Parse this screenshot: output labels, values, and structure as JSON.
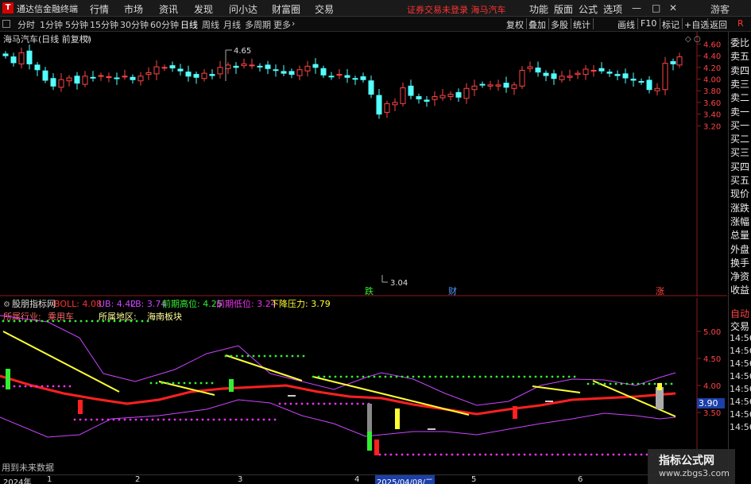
{
  "titlebar": {
    "app_name": "通达信金融终端",
    "menu": [
      "行情",
      "市场",
      "资讯",
      "发现",
      "问小达",
      "财富圈",
      "交易"
    ],
    "notice": "证券交易未登录  海马汽车",
    "right_menu": [
      "功能",
      "版面",
      "公式",
      "选项"
    ],
    "user": "游客"
  },
  "toolbar": {
    "periods": [
      "分时",
      "1分钟",
      "5分钟",
      "15分钟",
      "30分钟",
      "60分钟",
      "日线",
      "周线",
      "月线",
      "多周期",
      "更多"
    ],
    "active_period": "日线",
    "right_buttons": [
      "复权",
      "叠加",
      "多股",
      "统计",
      "画线",
      "F10",
      "标记",
      "+自选",
      "返回"
    ]
  },
  "main_chart": {
    "title": "海马汽车(日线 前复权)",
    "high_label": "4.65",
    "low_label": "3.04",
    "marks": [
      "跌",
      "财",
      "涨"
    ],
    "y_ticks": [
      "4.60",
      "4.40",
      "4.20",
      "4.00",
      "3.80",
      "3.60",
      "3.40",
      "3.20"
    ]
  },
  "indicator": {
    "name": "股朋指标网",
    "boll_label": "BOLL: 4.08",
    "ub_label": "UB: 4.42",
    "lb_label": "LB: 3.74",
    "prev_high_label": "前期高位: 4.25",
    "prev_low_label": "前期低位: 3.24",
    "pressure_label": "下降压力: 3.79",
    "industry_label": "所属行业:",
    "industry_value": "乘用车",
    "region_label": "所属地区:",
    "region_value": "海南板块",
    "y_ticks": [
      "5.00",
      "4.50",
      "4.00",
      "3.50"
    ],
    "current_price": "3.90",
    "future_note": "用到未来数据"
  },
  "bottom_axis": {
    "labels": [
      "2024年",
      "1",
      "2",
      "3",
      "4",
      "5",
      "6"
    ],
    "cursor_date": "2025/04/08/二"
  },
  "side_panel": {
    "quote_labels": [
      "委比",
      "卖五",
      "卖四",
      "卖三",
      "卖二",
      "卖一",
      "买一",
      "买二",
      "买三",
      "买四",
      "买五",
      "现价",
      "涨跌",
      "涨幅",
      "总量",
      "外盘",
      "换手",
      "净资",
      "收益"
    ],
    "auto_label": "自动",
    "trade_label": "交易",
    "times": [
      "14:56",
      "14:56",
      "14:56",
      "14:56",
      "14:56",
      "14:56",
      "14:56",
      "14:56"
    ]
  },
  "watermark": {
    "line1": "指标公式网",
    "line2": "www.zbgs3.com"
  },
  "colors": {
    "up": "#ff4444",
    "down": "#54ffff",
    "boll": "#ff2020",
    "band": "#cc44ff",
    "trend": "#ffff33",
    "high_dots": "#33ee33",
    "low_dots": "#ee33ee"
  }
}
